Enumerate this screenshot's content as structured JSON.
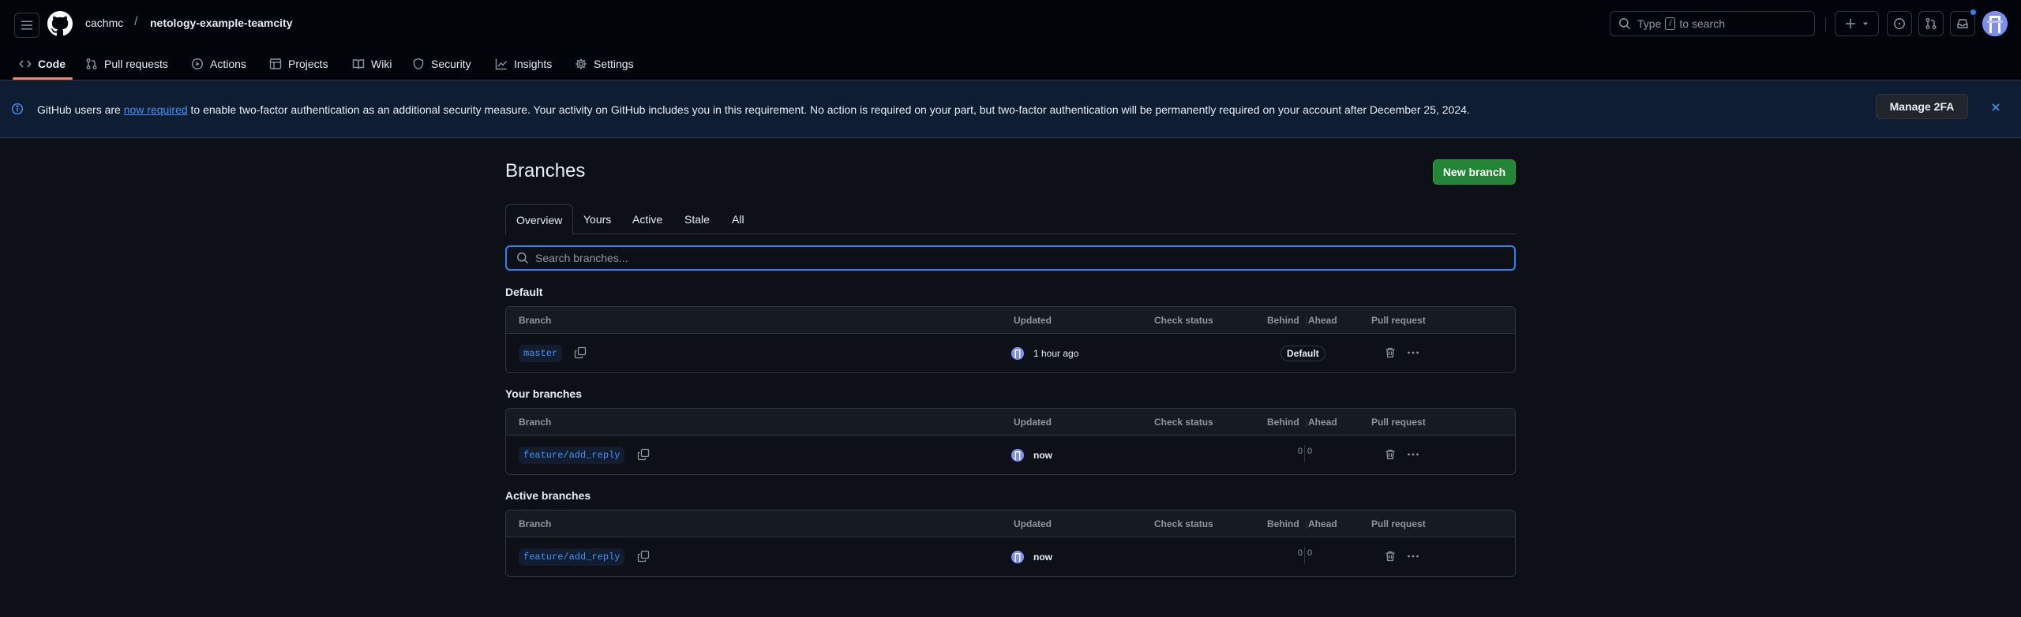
{
  "header": {
    "owner": "cachmc",
    "separator": "/",
    "repo": "netology-example-teamcity",
    "search_prefix": "Type",
    "search_key": "/",
    "search_suffix": "to search"
  },
  "nav": {
    "items": [
      {
        "label": "Code",
        "icon": "code-icon"
      },
      {
        "label": "Pull requests",
        "icon": "pull-request-icon"
      },
      {
        "label": "Actions",
        "icon": "play-icon"
      },
      {
        "label": "Projects",
        "icon": "table-icon"
      },
      {
        "label": "Wiki",
        "icon": "book-icon"
      },
      {
        "label": "Security",
        "icon": "shield-icon"
      },
      {
        "label": "Insights",
        "icon": "graph-icon"
      },
      {
        "label": "Settings",
        "icon": "gear-icon"
      }
    ]
  },
  "banner": {
    "text_before": "GitHub users are ",
    "link": "now required",
    "text_after": " to enable two-factor authentication as an additional security measure. Your activity on GitHub includes you in this requirement. No action is required on your part, but two-factor authentication will be permanently required on your account after December 25, 2024.",
    "button": "Manage 2FA"
  },
  "page": {
    "title": "Branches",
    "new_branch": "New branch",
    "tabs": [
      "Overview",
      "Yours",
      "Active",
      "Stale",
      "All"
    ],
    "search_placeholder": "Search branches..."
  },
  "columns": {
    "branch": "Branch",
    "updated": "Updated",
    "check_status": "Check status",
    "behind": "Behind",
    "ahead": "Ahead",
    "pull_request": "Pull request"
  },
  "sections": {
    "default": {
      "title": "Default",
      "row": {
        "branch": "master",
        "updated": "1 hour ago",
        "badge": "Default"
      }
    },
    "yours": {
      "title": "Your branches",
      "row": {
        "branch": "feature/add_reply",
        "updated": "now",
        "behind": "0",
        "ahead": "0"
      }
    },
    "active": {
      "title": "Active branches",
      "row": {
        "branch": "feature/add_reply",
        "updated": "now",
        "behind": "0",
        "ahead": "0"
      }
    }
  },
  "colors": {
    "accent": "#2f81f7",
    "primary_button": "#238636",
    "nav_underline": "#f78166",
    "background": "#0d1117"
  }
}
